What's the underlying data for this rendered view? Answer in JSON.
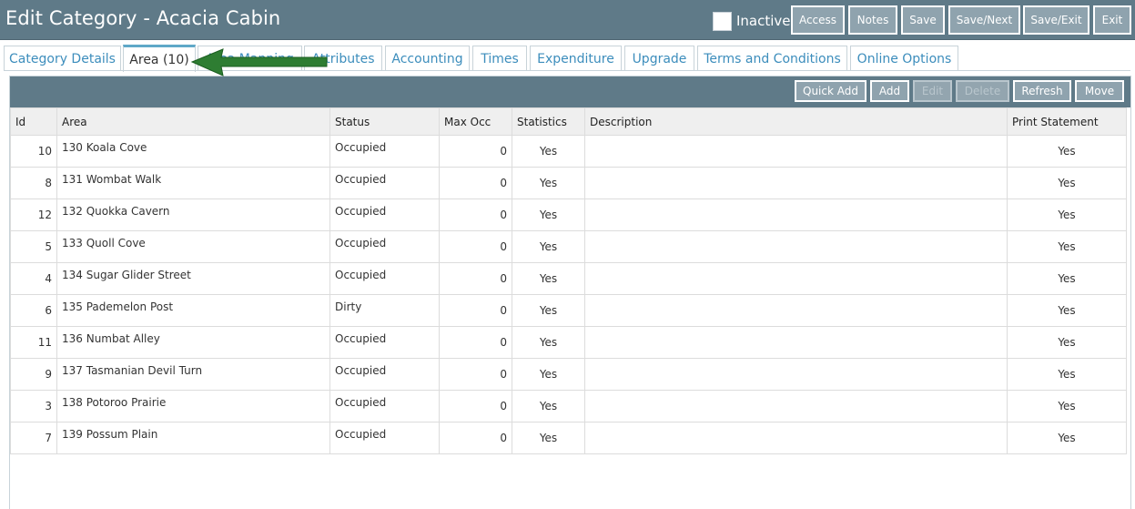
{
  "header": {
    "title": "Edit Category - Acacia Cabin",
    "inactive_label": "Inactive",
    "buttons": [
      "Access",
      "Notes",
      "Save",
      "Save/Next",
      "Save/Exit",
      "Exit"
    ]
  },
  "tabs": [
    {
      "label": "Category Details"
    },
    {
      "label": "Area (10)",
      "active": true
    },
    {
      "label": "Area Mapping"
    },
    {
      "label": "Attributes"
    },
    {
      "label": "Accounting"
    },
    {
      "label": "Times"
    },
    {
      "label": "Expenditure"
    },
    {
      "label": "Upgrade"
    },
    {
      "label": "Terms and Conditions"
    },
    {
      "label": "Online Options"
    }
  ],
  "toolbar": {
    "quick_add": "Quick Add",
    "add": "Add",
    "edit": "Edit",
    "delete": "Delete",
    "refresh": "Refresh",
    "move": "Move"
  },
  "table": {
    "columns": [
      "Id",
      "Area",
      "Status",
      "Max Occ",
      "Statistics",
      "Description",
      "Print Statement"
    ],
    "rows": [
      {
        "id": "10",
        "area": "130 Koala Cove",
        "status": "Occupied",
        "max_occ": "0",
        "statistics": "Yes",
        "description": "",
        "print_statement": "Yes"
      },
      {
        "id": "8",
        "area": "131 Wombat Walk",
        "status": "Occupied",
        "max_occ": "0",
        "statistics": "Yes",
        "description": "",
        "print_statement": "Yes"
      },
      {
        "id": "12",
        "area": "132 Quokka Cavern",
        "status": "Occupied",
        "max_occ": "0",
        "statistics": "Yes",
        "description": "",
        "print_statement": "Yes"
      },
      {
        "id": "5",
        "area": "133 Quoll Cove",
        "status": "Occupied",
        "max_occ": "0",
        "statistics": "Yes",
        "description": "",
        "print_statement": "Yes"
      },
      {
        "id": "4",
        "area": "134 Sugar Glider Street",
        "status": "Occupied",
        "max_occ": "0",
        "statistics": "Yes",
        "description": "",
        "print_statement": "Yes"
      },
      {
        "id": "6",
        "area": "135 Pademelon Post",
        "status": "Dirty",
        "max_occ": "0",
        "statistics": "Yes",
        "description": "",
        "print_statement": "Yes"
      },
      {
        "id": "11",
        "area": "136 Numbat Alley",
        "status": "Occupied",
        "max_occ": "0",
        "statistics": "Yes",
        "description": "",
        "print_statement": "Yes"
      },
      {
        "id": "9",
        "area": "137 Tasmanian Devil Turn",
        "status": "Occupied",
        "max_occ": "0",
        "statistics": "Yes",
        "description": "",
        "print_statement": "Yes"
      },
      {
        "id": "3",
        "area": "138 Potoroo Prairie",
        "status": "Occupied",
        "max_occ": "0",
        "statistics": "Yes",
        "description": "",
        "print_statement": "Yes"
      },
      {
        "id": "7",
        "area": "139 Possum Plain",
        "status": "Occupied",
        "max_occ": "0",
        "statistics": "Yes",
        "description": "",
        "print_statement": "Yes"
      }
    ]
  },
  "colors": {
    "header_bg": "#5f7a88",
    "button_bg": "#8fa3ae",
    "tab_text": "#3c8dbc",
    "arrow": "#2e7d32"
  },
  "annotation": {
    "arrow_icon": "green-arrow-icon"
  }
}
